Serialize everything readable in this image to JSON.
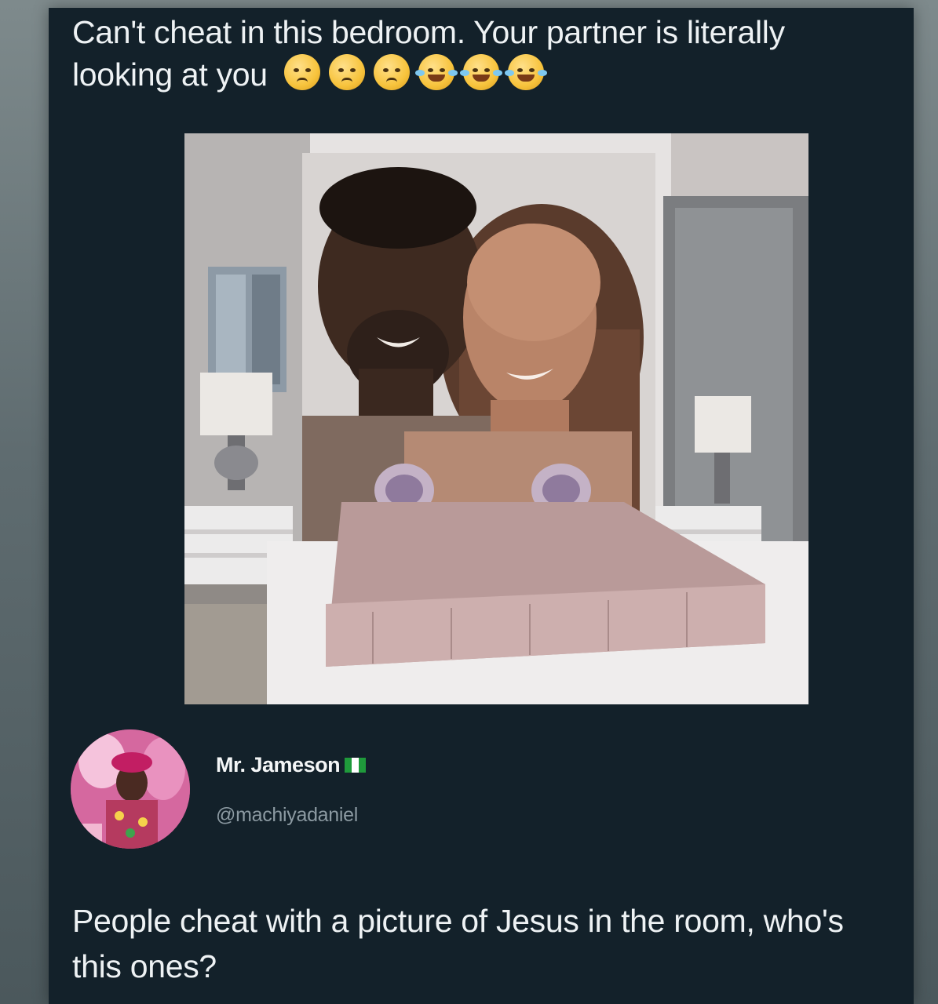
{
  "post": {
    "caption": "Can't cheat in this bedroom. Your partner is literally looking at you",
    "emojis": [
      "worried-face",
      "worried-face",
      "worried-face",
      "tears-of-joy",
      "tears-of-joy",
      "tears-of-joy"
    ]
  },
  "photo": {
    "subject": "bedroom-headboard-couple-photo"
  },
  "quote_tweet": {
    "display_name": "Mr. Jameson",
    "flag_icon": "nigeria-flag",
    "flag_colors": [
      "#1f9a3b",
      "#ffffff",
      "#1f9a3b"
    ],
    "handle": "@machiyadaniel",
    "text": "People cheat with a picture of Jesus in the room, who's this ones?"
  },
  "colors": {
    "card_background": "#13212a",
    "text": "#eef2f4",
    "handle": "#8c9aa2"
  }
}
